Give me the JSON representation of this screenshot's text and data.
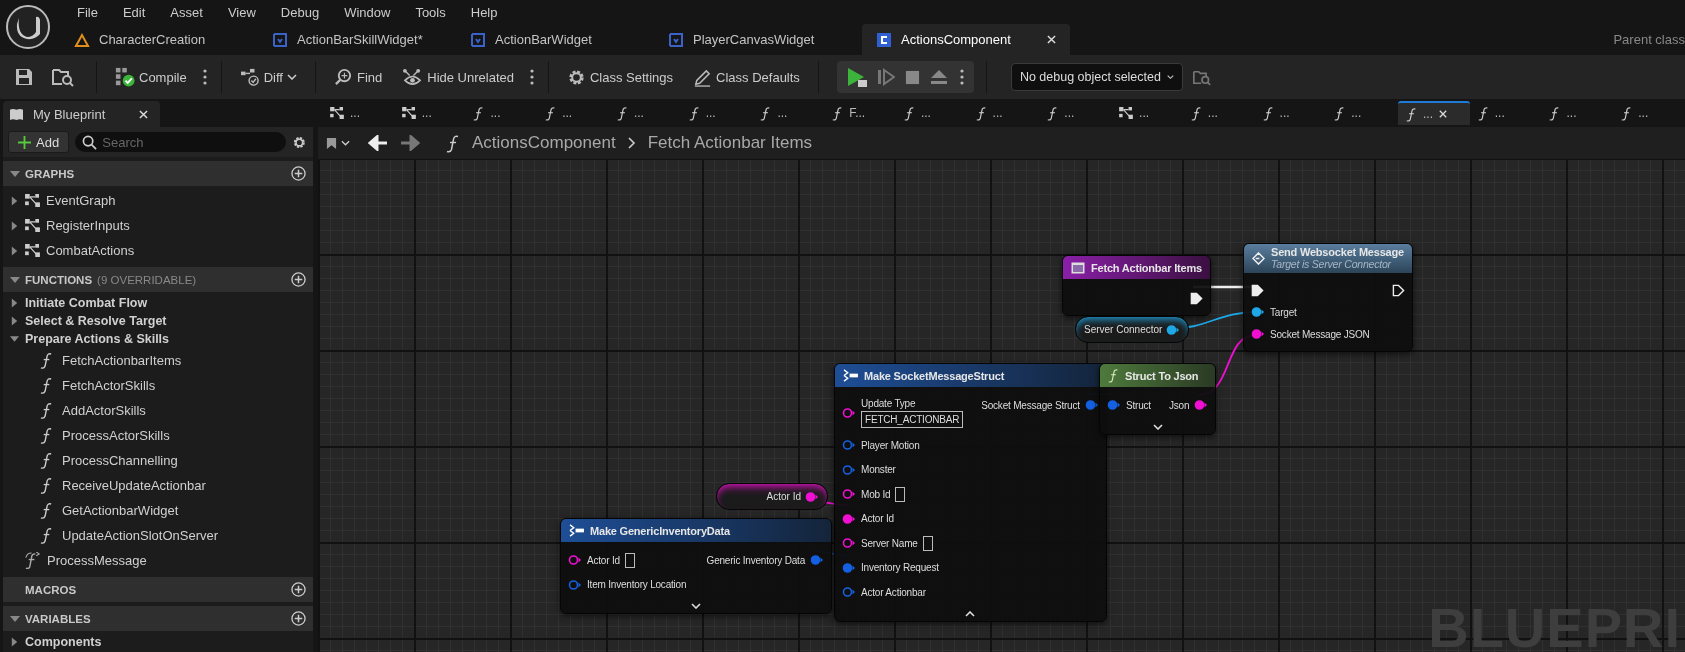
{
  "menu": [
    "File",
    "Edit",
    "Asset",
    "View",
    "Debug",
    "Window",
    "Tools",
    "Help"
  ],
  "document_tabs": [
    {
      "label": "CharacterCreation",
      "kind": "level",
      "selected": false
    },
    {
      "label": "ActionBarSkillWidget*",
      "kind": "widget",
      "selected": false
    },
    {
      "label": "ActionBarWidget",
      "kind": "widget",
      "selected": false
    },
    {
      "label": "PlayerCanvasWidget",
      "kind": "widget",
      "selected": false
    },
    {
      "label": "ActionsComponent",
      "kind": "component",
      "selected": true
    }
  ],
  "parent_class": "Parent class",
  "toolbar": {
    "buttons": [
      {
        "label": "Compile",
        "kind": "compile",
        "more": true
      },
      {
        "label": "Diff",
        "kind": "diff",
        "dropdown": true
      },
      {
        "label": "Find",
        "kind": "find"
      },
      {
        "label": "Hide Unrelated",
        "kind": "hide",
        "more": true
      },
      {
        "label": "Class Settings",
        "kind": "settings"
      },
      {
        "label": "Class Defaults",
        "kind": "defaults"
      }
    ],
    "debug_object": "No debug object selected"
  },
  "my_blueprint": {
    "title": "My Blueprint",
    "add_label": "Add",
    "search": {
      "placeholder": "Search"
    },
    "sections": [
      {
        "title": "GRAPHS",
        "expanded": true,
        "items": [
          {
            "label": "EventGraph",
            "kind": "graph",
            "expanded": false
          },
          {
            "label": "RegisterInputs",
            "kind": "graph",
            "expanded": false
          },
          {
            "label": "CombatActions",
            "kind": "graph",
            "expanded": false
          }
        ]
      },
      {
        "title": "FUNCTIONS",
        "note": "(9 OVERRIDABLE)",
        "expanded": true,
        "items": [
          {
            "label": "Initiate Combat Flow",
            "kind": "category",
            "expanded": false
          },
          {
            "label": "Select & Resolve Target",
            "kind": "category",
            "expanded": false
          },
          {
            "label": "Prepare Actions & Skills",
            "kind": "category",
            "expanded": true,
            "children": [
              {
                "label": "FetchActionbarItems",
                "kind": "function"
              },
              {
                "label": "FetchActorSkills",
                "kind": "function"
              },
              {
                "label": "AddActorSkills",
                "kind": "function"
              },
              {
                "label": "ProcessActorSkills",
                "kind": "function"
              },
              {
                "label": "ProcessChannelling",
                "kind": "function"
              },
              {
                "label": "ReceiveUpdateActionbar",
                "kind": "function"
              },
              {
                "label": "GetActionbarWidget",
                "kind": "function"
              },
              {
                "label": "UpdateActionSlotOnServer",
                "kind": "function"
              }
            ]
          },
          {
            "label": "ProcessMessage",
            "kind": "override"
          }
        ]
      },
      {
        "title": "MACROS"
      },
      {
        "title": "VARIABLES",
        "expanded": true,
        "items": [
          {
            "label": "Components",
            "kind": "category",
            "expanded": false
          }
        ]
      }
    ]
  },
  "graph_tabs": [
    {
      "kind": "graph",
      "label": "...",
      "selected": false
    },
    {
      "kind": "graph",
      "label": "...",
      "selected": false
    },
    {
      "kind": "function",
      "label": "...",
      "selected": false
    },
    {
      "kind": "function",
      "label": "...",
      "selected": false
    },
    {
      "kind": "function",
      "label": "...",
      "selected": false
    },
    {
      "kind": "function",
      "label": "...",
      "selected": false
    },
    {
      "kind": "function",
      "label": "...",
      "selected": false
    },
    {
      "kind": "function",
      "label": "F...",
      "selected": false
    },
    {
      "kind": "function",
      "label": "...",
      "selected": false
    },
    {
      "kind": "function",
      "label": "...",
      "selected": false
    },
    {
      "kind": "function",
      "label": "...",
      "selected": false
    },
    {
      "kind": "graph",
      "label": "...",
      "selected": false
    },
    {
      "kind": "function",
      "label": "...",
      "selected": false
    },
    {
      "kind": "function",
      "label": "...",
      "selected": false
    },
    {
      "kind": "function",
      "label": "...",
      "selected": false
    },
    {
      "kind": "function",
      "label": "...",
      "selected": true
    },
    {
      "kind": "function",
      "label": "...",
      "selected": false
    },
    {
      "kind": "function",
      "label": "...",
      "selected": false
    },
    {
      "kind": "function",
      "label": "...",
      "selected": false
    }
  ],
  "breadcrumb": [
    "ActionsComponent",
    "Fetch Actionbar Items"
  ],
  "nodes": [
    {
      "kind": "entry",
      "title": "Fetch Actionbar Items",
      "outputs": [
        {
          "kind": "exec",
          "connected": true
        }
      ]
    },
    {
      "kind": "call",
      "title": "Send Websocket Message",
      "subtitle": "Target is Server Connector",
      "inputs": [
        {
          "kind": "exec",
          "connected": true
        },
        {
          "kind": "data",
          "label": "Target",
          "color": "#1ea8e8",
          "connected": true
        },
        {
          "kind": "data",
          "label": "Socket Message JSON",
          "color": "#f00fd2",
          "connected": true
        }
      ],
      "outputs": [
        {
          "kind": "exec",
          "connected": false
        }
      ]
    },
    {
      "kind": "variable",
      "title": "Server Connector",
      "outputs": [
        {
          "kind": "data",
          "color": "#1ea8e8",
          "connected": true
        }
      ]
    },
    {
      "kind": "make_struct",
      "title": "Make SocketMessageStruct",
      "expanded": true,
      "inputs": [
        {
          "kind": "data",
          "label": "Update Type",
          "color": "#f00fd2",
          "connected": false,
          "value": "FETCH_ACTIONBAR"
        },
        {
          "kind": "data",
          "label": "Player Motion",
          "color": "#1460e0",
          "connected": false
        },
        {
          "kind": "data",
          "label": "Monster",
          "color": "#1460e0",
          "connected": false
        },
        {
          "kind": "data",
          "label": "Mob Id",
          "color": "#f00fd2",
          "connected": false,
          "empty_field": true
        },
        {
          "kind": "data",
          "label": "Actor Id",
          "color": "#f00fd2",
          "connected": true
        },
        {
          "kind": "data",
          "label": "Server Name",
          "color": "#f00fd2",
          "connected": false,
          "empty_field": true
        },
        {
          "kind": "data",
          "label": "Inventory Request",
          "color": "#1460e0",
          "connected": true
        },
        {
          "kind": "data",
          "label": "Actor Actionbar",
          "color": "#1460e0",
          "connected": false
        }
      ],
      "outputs": [
        {
          "kind": "data",
          "label": "Socket Message Struct",
          "color": "#1460e0",
          "connected": true
        }
      ]
    },
    {
      "kind": "pure_function",
      "title": "Struct To Json",
      "expanded": false,
      "inputs": [
        {
          "kind": "data",
          "label": "Struct",
          "color": "#1460e0",
          "connected": true
        }
      ],
      "outputs": [
        {
          "kind": "data",
          "label": "Json",
          "color": "#f00fd2",
          "connected": true
        }
      ]
    },
    {
      "kind": "variable",
      "title": "Actor Id",
      "outputs": [
        {
          "kind": "data",
          "color": "#f00fd2",
          "connected": true
        }
      ]
    },
    {
      "kind": "make_struct",
      "title": "Make GenericInventoryData",
      "expanded": false,
      "inputs": [
        {
          "kind": "data",
          "label": "Actor Id",
          "color": "#f00fd2",
          "connected": false,
          "empty_field": true
        },
        {
          "kind": "data",
          "label": "Item Inventory Location",
          "color": "#1460e0",
          "connected": false
        }
      ],
      "outputs": [
        {
          "kind": "data",
          "label": "Generic Inventory Data",
          "color": "#1460e0",
          "connected": true
        }
      ]
    }
  ],
  "graph_label": "BLUEPRI"
}
